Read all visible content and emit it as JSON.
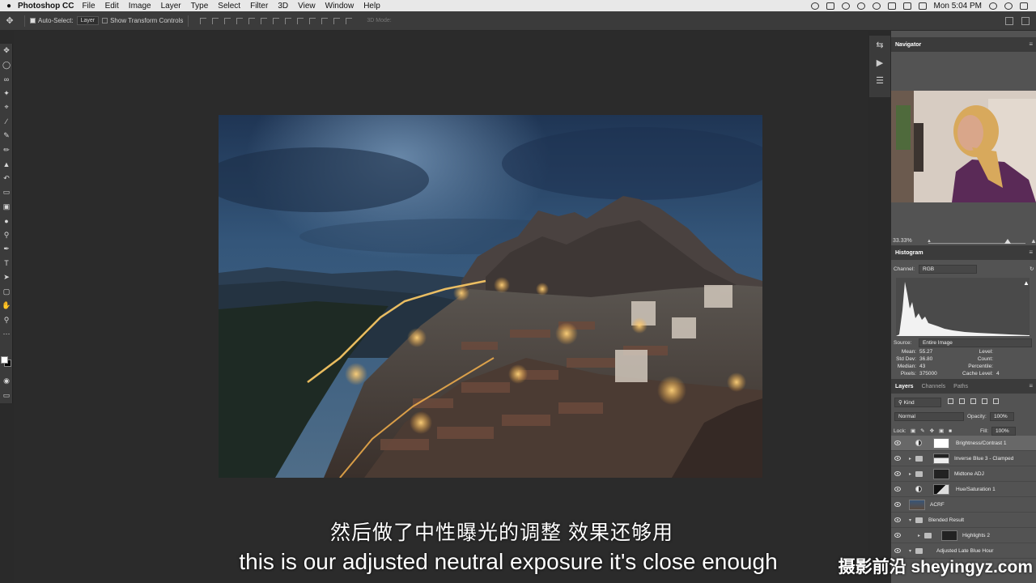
{
  "menubar": {
    "app_name": "Photoshop CC",
    "items": [
      "File",
      "Edit",
      "Image",
      "Layer",
      "Type",
      "Select",
      "Filter",
      "3D",
      "View",
      "Window",
      "Help"
    ],
    "clock": "Mon 5:04 PM"
  },
  "options_bar": {
    "auto_select_label": "Auto-Select:",
    "auto_select_value": "Layer",
    "transform_controls_label": "Show Transform Controls",
    "mode_3d_label": "3D Mode:"
  },
  "subtitles": {
    "chinese": "然后做了中性曝光的调整 效果还够用",
    "english": "this is our adjusted neutral exposure it's close enough"
  },
  "watermark": "摄影前沿 sheyingyz.com",
  "navigator": {
    "title": "Navigator",
    "zoom": "33.33%"
  },
  "histogram": {
    "title": "Histogram",
    "channel_label": "Channel:",
    "channel_value": "RGB",
    "source_label": "Source:",
    "source_value": "Entire Image",
    "stats_left_keys": [
      "Mean:",
      "Std Dev:",
      "Median:",
      "Pixels:"
    ],
    "stats_left_values": [
      "55.27",
      "36.80",
      "43",
      "375000"
    ],
    "stats_right_keys": [
      "Level:",
      "Count:",
      "Percentile:",
      "Cache Level:"
    ],
    "stats_right_values": [
      "",
      "",
      "",
      "4"
    ]
  },
  "layers_panel": {
    "tabs": [
      "Layers",
      "Channels",
      "Paths"
    ],
    "filter_kind": "Kind",
    "blend_mode": "Normal",
    "opacity_label": "Opacity:",
    "opacity_value": "100%",
    "lock_label": "Lock:",
    "fill_label": "Fill:",
    "fill_value": "100%",
    "layers": [
      {
        "name": "Brightness/Contrast 1"
      },
      {
        "name": "Inverse Blue 3 - Clamped"
      },
      {
        "name": "Midtone ADJ"
      },
      {
        "name": "Hue/Saturation 1"
      },
      {
        "name": "ACRF"
      },
      {
        "name": "Blended Result"
      },
      {
        "name": "Highlights 2"
      },
      {
        "name": "Adjusted Late Blue Hour"
      }
    ]
  },
  "colors": {
    "menubar_bg": "#e8e8e8",
    "workspace_bg": "#2b2b2b",
    "panel_bg": "#535353",
    "panel_header_bg": "#3b3b3b"
  }
}
